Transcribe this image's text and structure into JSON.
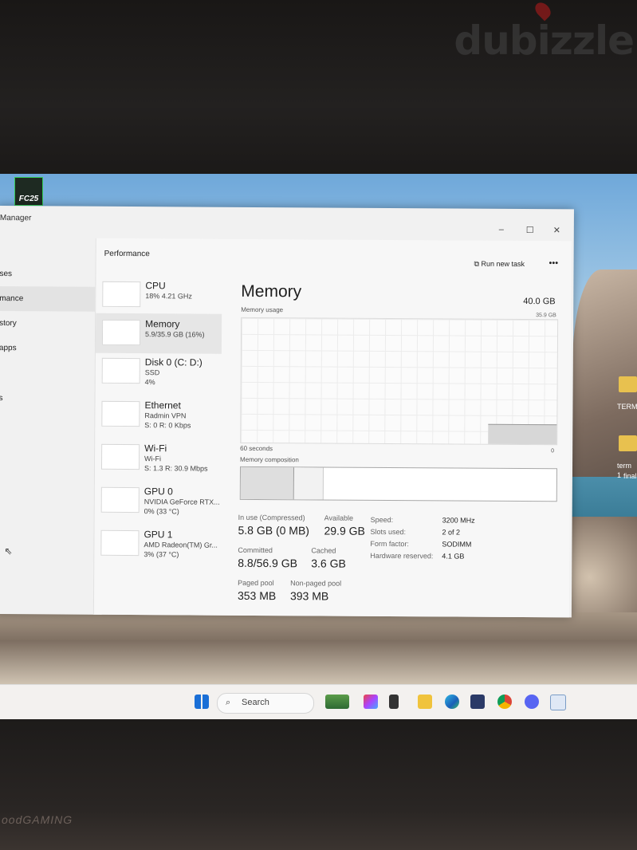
{
  "watermark": "dubizzle",
  "brand": "oodGAMING",
  "desktop": {
    "fc_icon": "FC25",
    "folder1_label": "TERM",
    "folder2_label_1": "term 1",
    "folder2_label_2": "final"
  },
  "window": {
    "title": "Manager",
    "minimize": "–",
    "maximize": "☐",
    "close": "✕"
  },
  "nav": [
    "ses",
    "mance",
    "story",
    "apps",
    "s"
  ],
  "header": {
    "title": "Performance",
    "run_new_task": "Run new task",
    "more": "•••"
  },
  "devices": [
    {
      "name": "CPU",
      "sub1": "18%  4.21 GHz",
      "sub2": ""
    },
    {
      "name": "Memory",
      "sub1": "5.9/35.9 GB (16%)",
      "sub2": ""
    },
    {
      "name": "Disk 0 (C: D:)",
      "sub1": "SSD",
      "sub2": "4%"
    },
    {
      "name": "Ethernet",
      "sub1": "Radmin VPN",
      "sub2": "S: 0  R: 0 Kbps"
    },
    {
      "name": "Wi-Fi",
      "sub1": "Wi-Fi",
      "sub2": "S: 1.3  R: 30.9 Mbps"
    },
    {
      "name": "GPU 0",
      "sub1": "NVIDIA GeForce RTX...",
      "sub2": "0% (33 °C)"
    },
    {
      "name": "GPU 1",
      "sub1": "AMD Radeon(TM) Gr...",
      "sub2": "3% (37 °C)"
    }
  ],
  "memory": {
    "title": "Memory",
    "total": "40.0 GB",
    "usage_label": "Memory usage",
    "max_label": "35.9 GB",
    "time_label": "60 seconds",
    "zero_label": "0",
    "composition_label": "Memory composition",
    "in_use_label": "In use (Compressed)",
    "in_use_value": "5.8 GB (0 MB)",
    "available_label": "Available",
    "available_value": "29.9 GB",
    "committed_label": "Committed",
    "committed_value": "8.8/56.9 GB",
    "cached_label": "Cached",
    "cached_value": "3.6 GB",
    "paged_label": "Paged pool",
    "paged_value": "353 MB",
    "nonpaged_label": "Non-paged pool",
    "nonpaged_value": "393 MB",
    "speed_label": "Speed:",
    "speed_value": "3200 MHz",
    "slots_label": "Slots used:",
    "slots_value": "2 of 2",
    "form_label": "Form factor:",
    "form_value": "SODIMM",
    "hw_label": "Hardware reserved:",
    "hw_value": "4.1 GB"
  },
  "taskbar": {
    "search": "Search"
  }
}
